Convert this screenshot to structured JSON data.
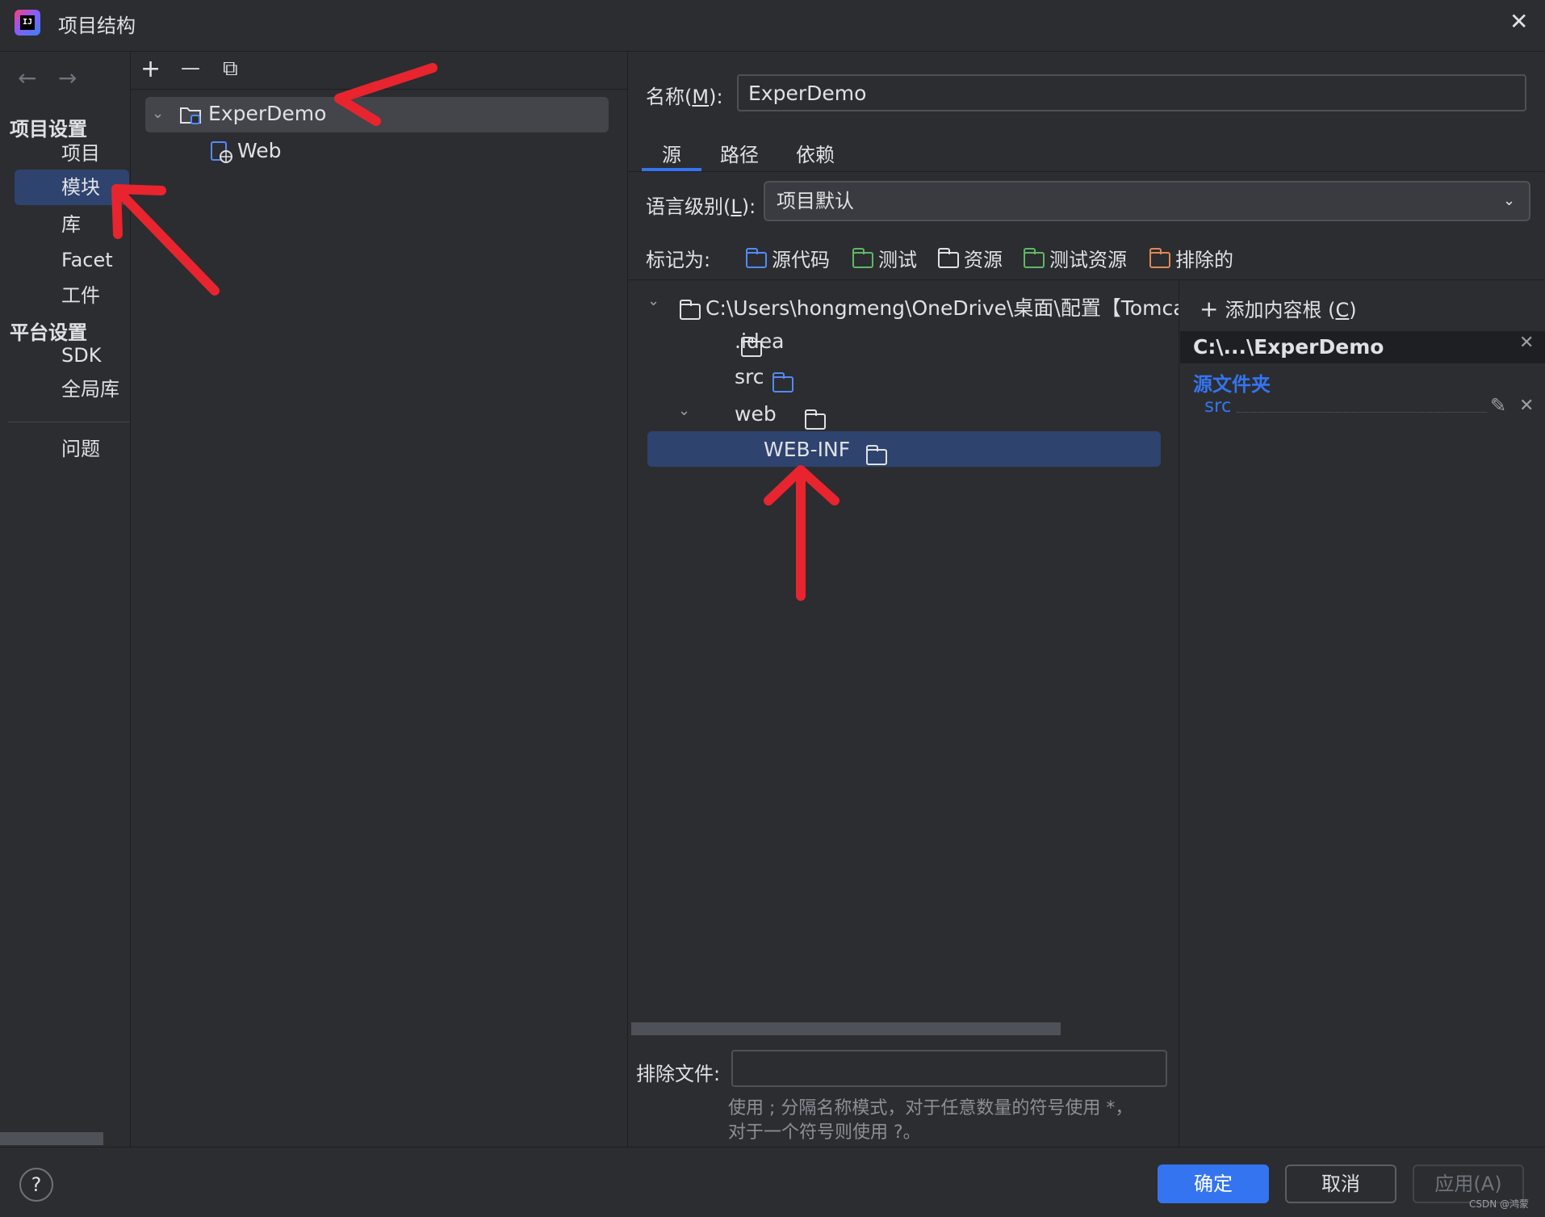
{
  "window": {
    "title": "项目结构",
    "close": "✕"
  },
  "nav": {
    "back": "←",
    "forward": "→",
    "project_settings": "项目设置",
    "project_items": [
      "项目",
      "模块",
      "库",
      "Facet",
      "工件"
    ],
    "platform_settings": "平台设置",
    "platform_items": [
      "SDK",
      "全局库"
    ],
    "problems": "问题"
  },
  "modules": {
    "toolbar": {
      "add": "+",
      "remove": "—",
      "copy": "⧉"
    },
    "tree": [
      {
        "label": "ExperDemo",
        "expanded": true
      },
      {
        "label": "Web"
      }
    ]
  },
  "details": {
    "name_label": "名称(M):",
    "name_mnemonic_label": "名称(",
    "name_mnemonic": "M",
    "name_suffix": "):",
    "name_value": "ExperDemo",
    "tabs": [
      "源",
      "路径",
      "依赖"
    ],
    "language_level_prefix": "语言级别(",
    "language_level_mnemonic": "L",
    "language_level_suffix": "):",
    "language_level_value": "项目默认",
    "mark_as_label": "标记为:",
    "mark_as": [
      {
        "label": "源代码",
        "color": "#548af7"
      },
      {
        "label": "测试",
        "color": "#5fb865"
      },
      {
        "label": "资源",
        "color": "#dfe1e5"
      },
      {
        "label": "测试资源",
        "color": "#5fb865"
      },
      {
        "label": "排除的",
        "color": "#e08855"
      }
    ],
    "content_tree": {
      "root": "C:\\Users\\hongmeng\\OneDrive\\桌面\\配置【Tomcat】",
      "children": [
        ".idea",
        "src",
        "web"
      ],
      "web_children": [
        "WEB-INF"
      ]
    },
    "exclude_files_label": "排除文件:",
    "exclude_files_value": "",
    "hint_line1": "使用 ; 分隔名称模式，对于任意数量的符号使用 *，",
    "hint_line2": "对于一个符号则使用 ?。"
  },
  "content_roots": {
    "add_label_prefix": "添加内容根 (",
    "add_mnemonic": "C",
    "add_label_suffix": ")",
    "root_title": "C:\\...\\ExperDemo",
    "source_folders_label": "源文件夹",
    "source_folders": [
      "src"
    ]
  },
  "footer": {
    "help": "?",
    "ok": "确定",
    "cancel": "取消",
    "apply": "应用(A)",
    "watermark": "CSDN @鸿蒙"
  },
  "colors": {
    "accent": "#3574f0",
    "selection": "#2e436e",
    "annotation": "#e8242f"
  }
}
